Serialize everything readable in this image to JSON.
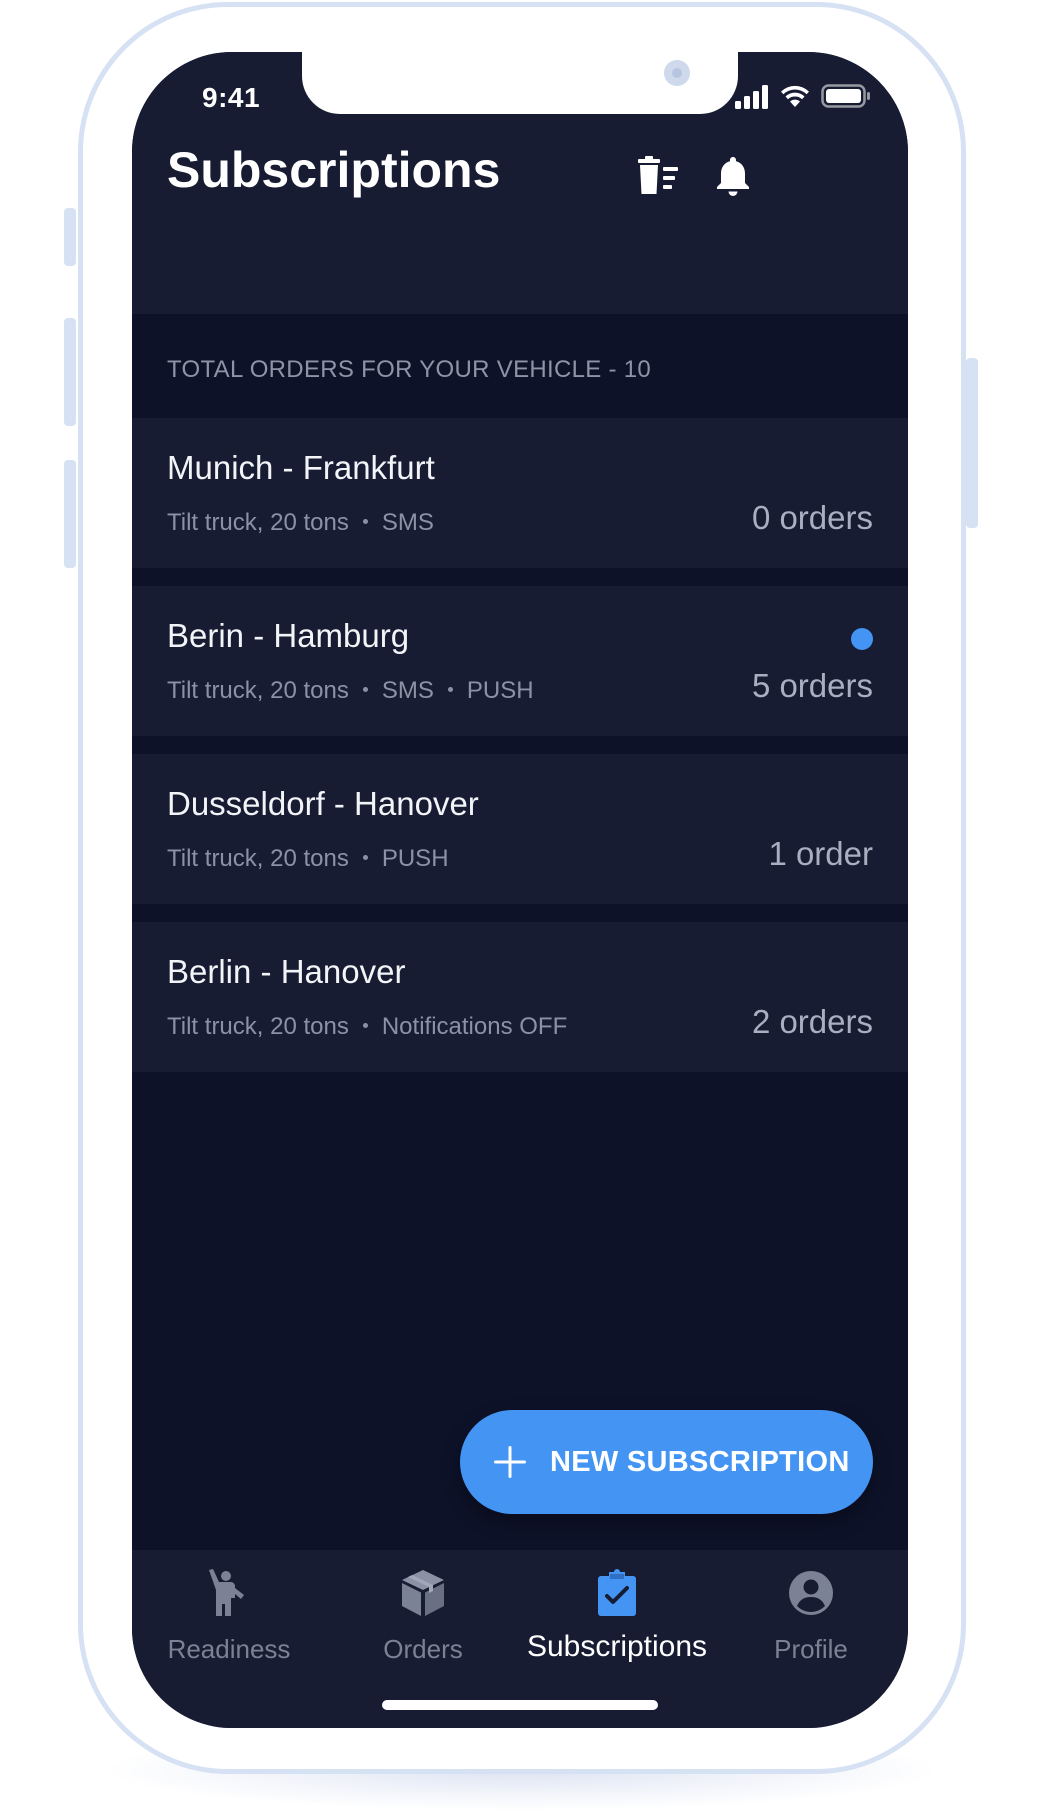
{
  "status_bar": {
    "time": "9:41",
    "icons": [
      "signal-icon",
      "wifi-icon",
      "battery-icon"
    ]
  },
  "header": {
    "title": "Subscriptions",
    "actions": [
      "clear-all-icon",
      "bell-icon"
    ]
  },
  "summary": {
    "total_text": "TOTAL ORDERS FOR YOUR VEHICLE - 10"
  },
  "subscriptions": [
    {
      "route": "Munich - Frankfurt",
      "vehicle": "Tilt truck, 20 tons",
      "channels": [
        "SMS"
      ],
      "count": "0 orders",
      "unread": false
    },
    {
      "route": "Berin - Hamburg",
      "vehicle": "Tilt truck, 20 tons",
      "channels": [
        "SMS",
        "PUSH"
      ],
      "count": "5 orders",
      "unread": true
    },
    {
      "route": "Dusseldorf - Hanover",
      "vehicle": "Tilt truck, 20 tons",
      "channels": [
        "PUSH"
      ],
      "count": "1 order",
      "unread": false
    },
    {
      "route": "Berlin - Hanover",
      "vehicle": "Tilt truck, 20 tons",
      "channels": [
        "Notifications OFF"
      ],
      "count": "2 orders",
      "unread": false
    }
  ],
  "fab": {
    "label": "NEW SUBSCRIPTION",
    "icon": "plus-icon"
  },
  "bottom_nav": {
    "items": [
      {
        "label": "Readiness",
        "icon": "person-waving-icon",
        "active": false
      },
      {
        "label": "Orders",
        "icon": "box-icon",
        "active": false
      },
      {
        "label": "Subscriptions",
        "icon": "clipboard-check-icon",
        "active": true
      },
      {
        "label": "Profile",
        "icon": "account-circle-icon",
        "active": false
      }
    ]
  },
  "colors": {
    "background": "#0d1229",
    "surface": "#171c32",
    "accent": "#4394f3",
    "text_primary": "#f2f4f8",
    "text_secondary": "#8b91a6",
    "device_frame": "#d6e1f3"
  }
}
